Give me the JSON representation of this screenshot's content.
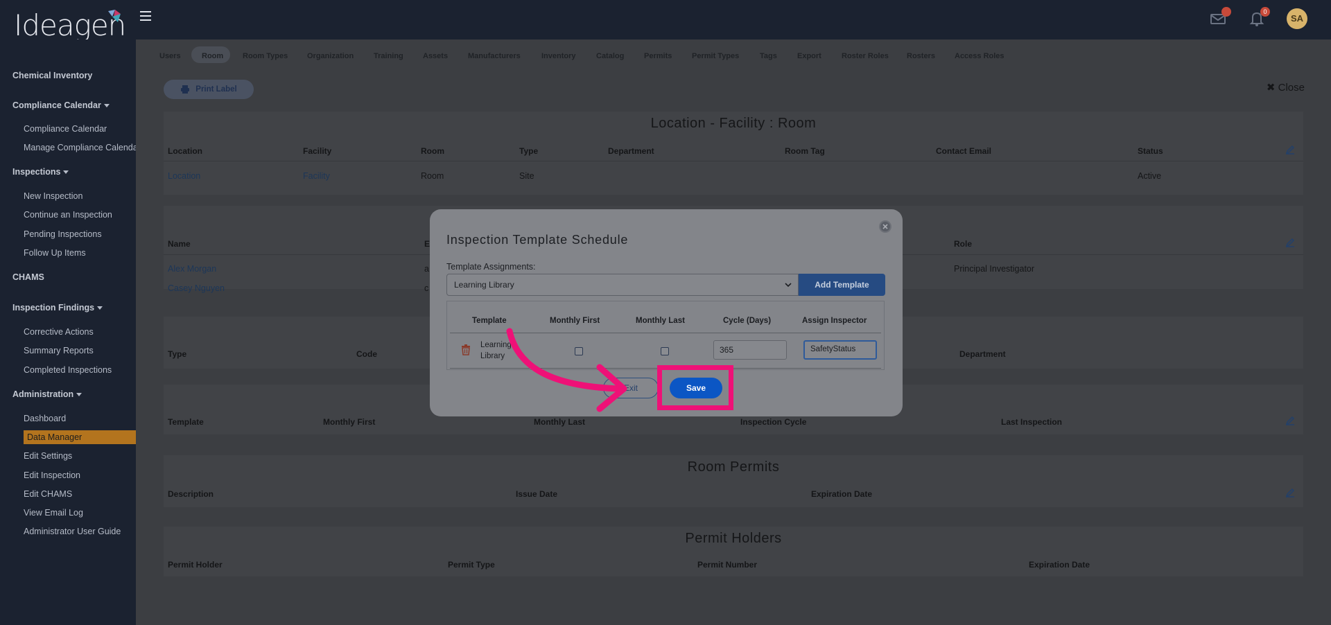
{
  "brand": {
    "logo_text": "Ideagen"
  },
  "topbar": {
    "notifications_count": "0",
    "avatar_initials": "SA"
  },
  "sidebar": {
    "chemical_inventory": "Chemical Inventory",
    "compliance_calendar": "Compliance Calendar",
    "compliance_calendar_item": "Compliance Calendar",
    "manage_compliance_calendar": "Manage Compliance Calendar",
    "inspections": "Inspections",
    "new_inspection": "New Inspection",
    "continue_inspection": "Continue an Inspection",
    "pending_inspections": "Pending Inspections",
    "follow_up_items": "Follow Up Items",
    "chams": "CHAMS",
    "inspection_findings": "Inspection Findings",
    "corrective_actions": "Corrective Actions",
    "summary_reports": "Summary Reports",
    "completed_inspections": "Completed Inspections",
    "administration": "Administration",
    "dashboard": "Dashboard",
    "data_manager": "Data Manager",
    "edit_settings": "Edit Settings",
    "edit_inspection": "Edit Inspection",
    "edit_chams": "Edit CHAMS",
    "view_email_log": "View Email Log",
    "admin_user_guide": "Administrator User Guide"
  },
  "tabs": [
    "Users",
    "Room",
    "Room Types",
    "Organization",
    "Training",
    "Assets",
    "Manufacturers",
    "Inventory",
    "Catalog",
    "Permits",
    "Permit Types",
    "Tags",
    "Export",
    "Roster Roles",
    "Rosters",
    "Access Roles"
  ],
  "main": {
    "print_label": "Print Label",
    "close": "Close",
    "location_panel": {
      "title": "Location - Facility : Room",
      "headers": [
        "Location",
        "Facility",
        "Room",
        "Type",
        "Department",
        "Room Tag",
        "Contact Email",
        "Status"
      ],
      "row": {
        "location": "Location",
        "facility": "Facility",
        "room": "Room",
        "type": "Site",
        "status": "Active"
      }
    },
    "people_panel": {
      "headers": {
        "name": "Name",
        "e": "E",
        "role": "Role"
      },
      "rows": [
        {
          "name": "Alex Morgan",
          "e": "a",
          "role": "Principal Investigator"
        },
        {
          "name": "Casey Nguyen",
          "e": "c",
          "role": ""
        }
      ]
    },
    "type_panel": {
      "headers": {
        "type": "Type",
        "code": "Code",
        "department": "Department"
      }
    },
    "template_panel": {
      "headers": [
        "Template",
        "Monthly First",
        "Monthly Last",
        "Inspection Cycle",
        "Last Inspection"
      ]
    },
    "permits_panel": {
      "title": "Room Permits",
      "headers": [
        "Description",
        "Issue Date",
        "Expiration Date"
      ]
    },
    "holders_panel": {
      "title": "Permit Holders",
      "headers": [
        "Permit Holder",
        "Permit Type",
        "Permit Number",
        "Expiration Date"
      ]
    }
  },
  "modal": {
    "title": "Inspection Template Schedule",
    "assign_label": "Template Assignments:",
    "selected_template": "Learning Library",
    "add_template": "Add Template",
    "table_headers": [
      "Template",
      "Monthly First",
      "Monthly Last",
      "Cycle (Days)",
      "Assign Inspector"
    ],
    "row": {
      "template": "Learning Library",
      "cycle": "365",
      "inspector": "SafetyStatus"
    },
    "exit": "Exit",
    "save": "Save"
  },
  "colors": {
    "highlight": "#ee1177",
    "primary": "#0b56c4"
  }
}
